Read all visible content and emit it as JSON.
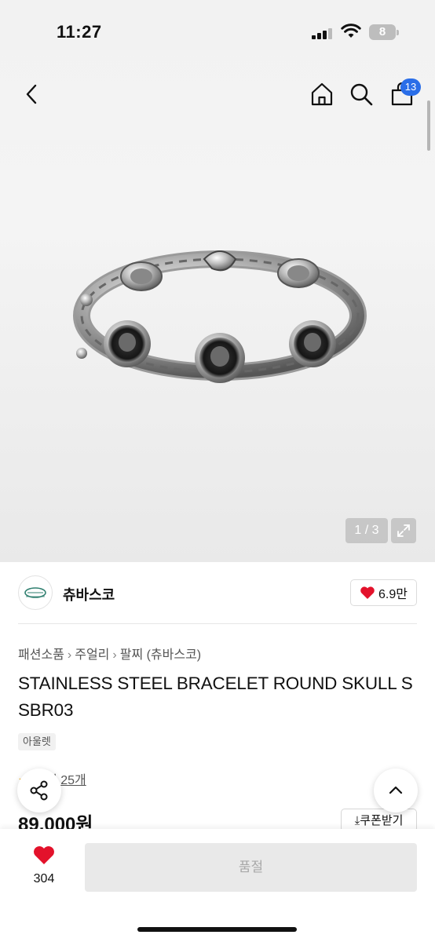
{
  "status_bar": {
    "time": "11:27",
    "battery": "8"
  },
  "header": {
    "cart_count": "13"
  },
  "gallery": {
    "current": "1",
    "total": "3",
    "separator": " / "
  },
  "seller": {
    "name": "츄바스코",
    "likes": "6.9만"
  },
  "breadcrumb": [
    "패션소품",
    "주얼리",
    "팔찌 (츄바스코)"
  ],
  "product": {
    "title": "STAINLESS STEEL BRACELET ROUND SKULL SSBR03",
    "tag": "아울렛",
    "reviews": "후기 25개",
    "price": "89,000원",
    "coupon_label": "쿠폰받기"
  },
  "bottom": {
    "wish_count": "304",
    "soldout_label": "품절"
  },
  "colors": {
    "accent_blue": "#2a6ee8",
    "heart_red": "#e3122b",
    "star_yellow": "#f0a500"
  },
  "icons": [
    "back-icon",
    "home-icon",
    "search-icon",
    "cart-icon",
    "expand-icon",
    "heart-icon",
    "share-icon",
    "arrow-up-icon",
    "download-icon"
  ]
}
